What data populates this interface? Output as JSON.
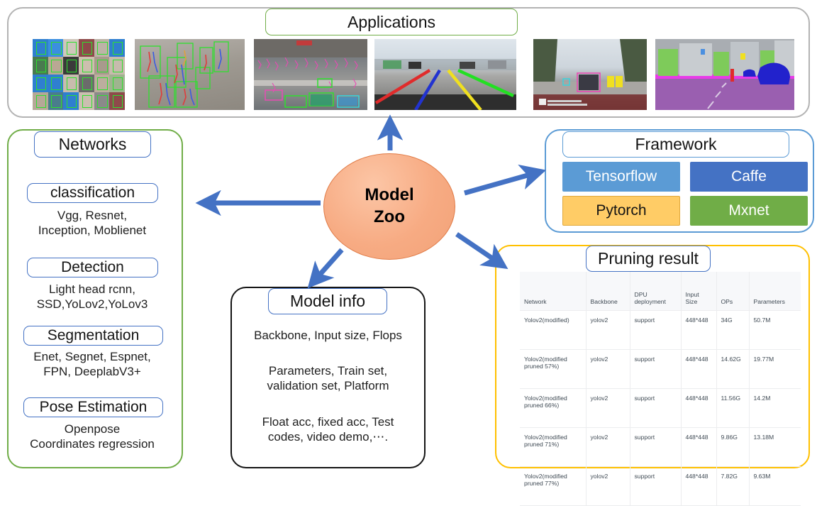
{
  "applications": {
    "title": "Applications",
    "border_color": "#70AD47",
    "images": [
      {
        "name": "face-recognition-grid",
        "caption": "face detection grid"
      },
      {
        "name": "pose-estimation-pedestrians",
        "caption": "pedestrian pose estimation"
      },
      {
        "name": "traffic-intersection-detection",
        "caption": "traffic intersection detection"
      },
      {
        "name": "lane-detection-road",
        "caption": "lane detection"
      },
      {
        "name": "vehicle-detection-dashcam",
        "caption": "dashcam vehicle detection"
      },
      {
        "name": "semantic-segmentation-street",
        "caption": "semantic segmentation"
      }
    ]
  },
  "networks": {
    "title": "Networks",
    "border_color": "#70AD47",
    "sections": [
      {
        "heading": "classification",
        "body": "Vgg, Resnet,\nInception, Moblienet"
      },
      {
        "heading": "Detection",
        "body": "Light head rcnn,\nSSD,YoLov2,YoLov3"
      },
      {
        "heading": "Segmentation",
        "body": "Enet, Segnet, Espnet,\nFPN, DeeplabV3+"
      },
      {
        "heading": "Pose Estimation",
        "body": "Openpose\nCoordinates regression"
      }
    ]
  },
  "center": {
    "label_line1": "Model",
    "label_line2": "Zoo",
    "fill_color": "#F7AB83"
  },
  "framework": {
    "title": "Framework",
    "border_color": "#5B9BD5",
    "buttons": [
      {
        "label": "Tensorflow",
        "bg": "#5B9BD5",
        "fg": "#ffffff"
      },
      {
        "label": "Caffe",
        "bg": "#4472C4",
        "fg": "#ffffff"
      },
      {
        "label": "Pytorch",
        "bg": "#FFCC66",
        "fg": "#141414"
      },
      {
        "label": "Mxnet",
        "bg": "#70AD47",
        "fg": "#ffffff"
      }
    ]
  },
  "model_info": {
    "title": "Model info",
    "border_color": "#141414",
    "lines": [
      "Backbone, Input size, Flops",
      "Parameters, Train set,\nvalidation set, Platform",
      "Float acc, fixed acc, Test\ncodes, video demo,⋯."
    ]
  },
  "pruning": {
    "title": "Pruning result",
    "border_color": "#FFC000",
    "columns": [
      "Network",
      "Backbone",
      "DPU deployment",
      "Input Size",
      "OPs",
      "Parameters"
    ],
    "rows": [
      [
        "Yolov2(modified)",
        "yolov2",
        "support",
        "448*448",
        "34G",
        "50.7M"
      ],
      [
        "Yolov2(modified pruned 57%)",
        "yolov2",
        "support",
        "448*448",
        "14.62G",
        "19.77M"
      ],
      [
        "Yolov2(modified pruned 66%)",
        "yolov2",
        "support",
        "448*448",
        "11.56G",
        "14.2M"
      ],
      [
        "Yolov2(modified pruned 71%)",
        "yolov2",
        "support",
        "448*448",
        "9.86G",
        "13.18M"
      ],
      [
        "Yolov2(modified pruned 77%)",
        "yolov2",
        "support",
        "448*448",
        "7.82G",
        "9.63M"
      ]
    ]
  },
  "arrows": {
    "color": "#4472C4",
    "items": [
      {
        "name": "arrow-to-applications",
        "direction": "up"
      },
      {
        "name": "arrow-to-networks",
        "direction": "left"
      },
      {
        "name": "arrow-to-framework",
        "direction": "upright"
      },
      {
        "name": "arrow-to-model-info",
        "direction": "downleft"
      },
      {
        "name": "arrow-to-pruning-result",
        "direction": "downright"
      }
    ]
  }
}
